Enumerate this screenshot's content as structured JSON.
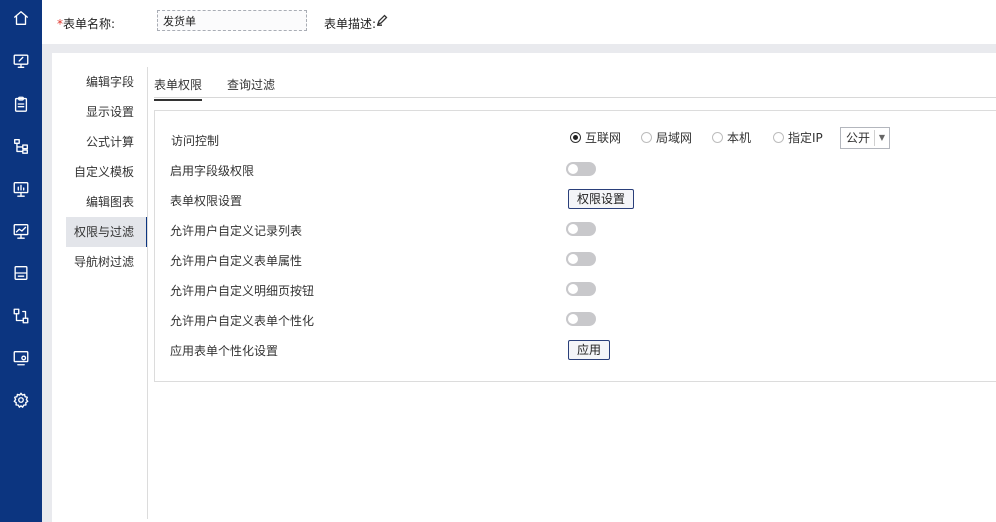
{
  "colors": {
    "rail": "#0c3580",
    "required": "#e0342a"
  },
  "rail_icons": [
    "home-icon",
    "monitor-edit-icon",
    "clipboard-icon",
    "org-chart-icon",
    "dashboard-icon",
    "chart-icon",
    "layout-icon",
    "flow-icon",
    "screen-settings-icon",
    "gear-icon"
  ],
  "header": {
    "required_mark": "*",
    "form_name_label": "表单名称:",
    "form_name_value": "发货单",
    "form_desc_label": "表单描述:"
  },
  "sidebar": {
    "items": [
      {
        "label": "编辑字段"
      },
      {
        "label": "显示设置"
      },
      {
        "label": "公式计算"
      },
      {
        "label": "自定义模板"
      },
      {
        "label": "编辑图表"
      },
      {
        "label": "权限与过滤"
      },
      {
        "label": "导航树过滤"
      }
    ],
    "active": "权限与过滤"
  },
  "tabs": [
    {
      "label": "表单权限",
      "active": true
    },
    {
      "label": "查询过滤",
      "active": false
    }
  ],
  "settings": {
    "access_control": {
      "label": "访问控制",
      "options": [
        "互联网",
        "局域网",
        "本机",
        "指定IP"
      ],
      "selected": "互联网",
      "select_value": "公开"
    },
    "field_permission": {
      "label": "启用字段级权限",
      "on": false
    },
    "form_permission": {
      "label": "表单权限设置",
      "button": "权限设置"
    },
    "custom_record_list": {
      "label": "允许用户自定义记录列表",
      "on": false
    },
    "custom_form_props": {
      "label": "允许用户自定义表单属性",
      "on": false
    },
    "custom_detail_buttons": {
      "label": "允许用户自定义明细页按钮",
      "on": false
    },
    "custom_personalize": {
      "label": "允许用户自定义表单个性化",
      "on": false
    },
    "apply_personalize": {
      "label": "应用表单个性化设置",
      "button": "应用"
    }
  }
}
